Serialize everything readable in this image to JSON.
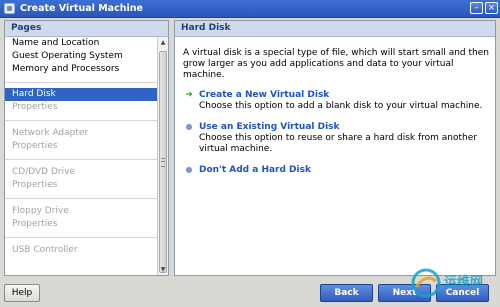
{
  "window": {
    "title": "Create Virtual Machine",
    "close_glyph": "×"
  },
  "pages_panel": {
    "header": "Pages",
    "items": [
      {
        "label": "Name and Location",
        "state": "normal"
      },
      {
        "label": "Guest Operating System",
        "state": "normal"
      },
      {
        "label": "Memory and Processors",
        "state": "normal"
      },
      {
        "label": "Hard Disk",
        "state": "selected"
      },
      {
        "label": "Properties",
        "state": "disabled"
      },
      {
        "label": "Network Adapter",
        "state": "disabled"
      },
      {
        "label": "Properties",
        "state": "disabled"
      },
      {
        "label": "CD/DVD Drive",
        "state": "disabled"
      },
      {
        "label": "Properties",
        "state": "disabled"
      },
      {
        "label": "Floppy Drive",
        "state": "disabled"
      },
      {
        "label": "Properties",
        "state": "disabled"
      },
      {
        "label": "USB Controller",
        "state": "disabled"
      }
    ]
  },
  "content_panel": {
    "header": "Hard Disk",
    "intro": "A virtual disk is a special type of file, which will start small and then grow larger as you add applications and data to your virtual machine.",
    "options": [
      {
        "icon": "green-arrow-icon",
        "title": "Create a New Virtual Disk",
        "description": "Choose this option to add a blank disk to your virtual machine."
      },
      {
        "icon": "bullet-icon",
        "title": "Use an Existing Virtual Disk",
        "description": "Choose this option to reuse or share a hard disk from another virtual machine."
      },
      {
        "icon": "bullet-icon",
        "title": "Don't Add a Hard Disk",
        "description": ""
      }
    ]
  },
  "buttons": {
    "help": "Help",
    "back": "Back",
    "next": "Next",
    "cancel": "Cancel"
  },
  "watermark": {
    "text": "运维网"
  },
  "colors": {
    "title_bar": "#2f5cc0",
    "selected_item": "#3163c5",
    "link_blue": "#1f53c5",
    "arrow_green": "#2da336"
  }
}
